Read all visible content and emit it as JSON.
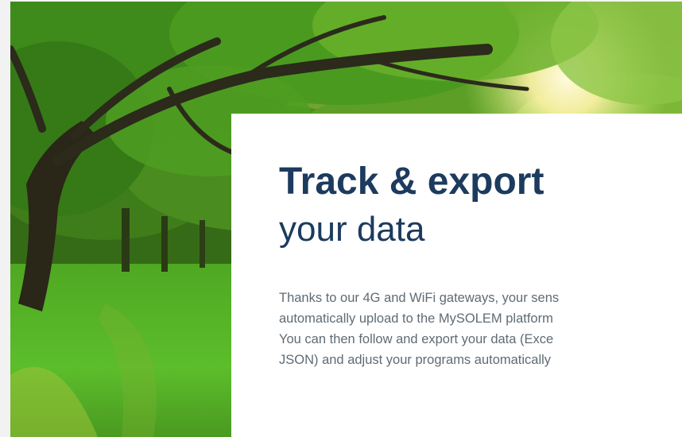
{
  "hero": {
    "image": "sunlit-tree-park-photo"
  },
  "card": {
    "headline": "Track & export",
    "subheadline": "your data",
    "body_lines": [
      "Thanks to our 4G and WiFi gateways, your sens",
      "automatically upload to the MySOLEM platform",
      "You can then follow and export your data (Exce",
      "JSON) and adjust your programs automatically"
    ]
  },
  "colors": {
    "heading": "#1c3b5e",
    "body": "#5f6b74",
    "card_bg": "#ffffff",
    "foliage": "#4fa223"
  }
}
